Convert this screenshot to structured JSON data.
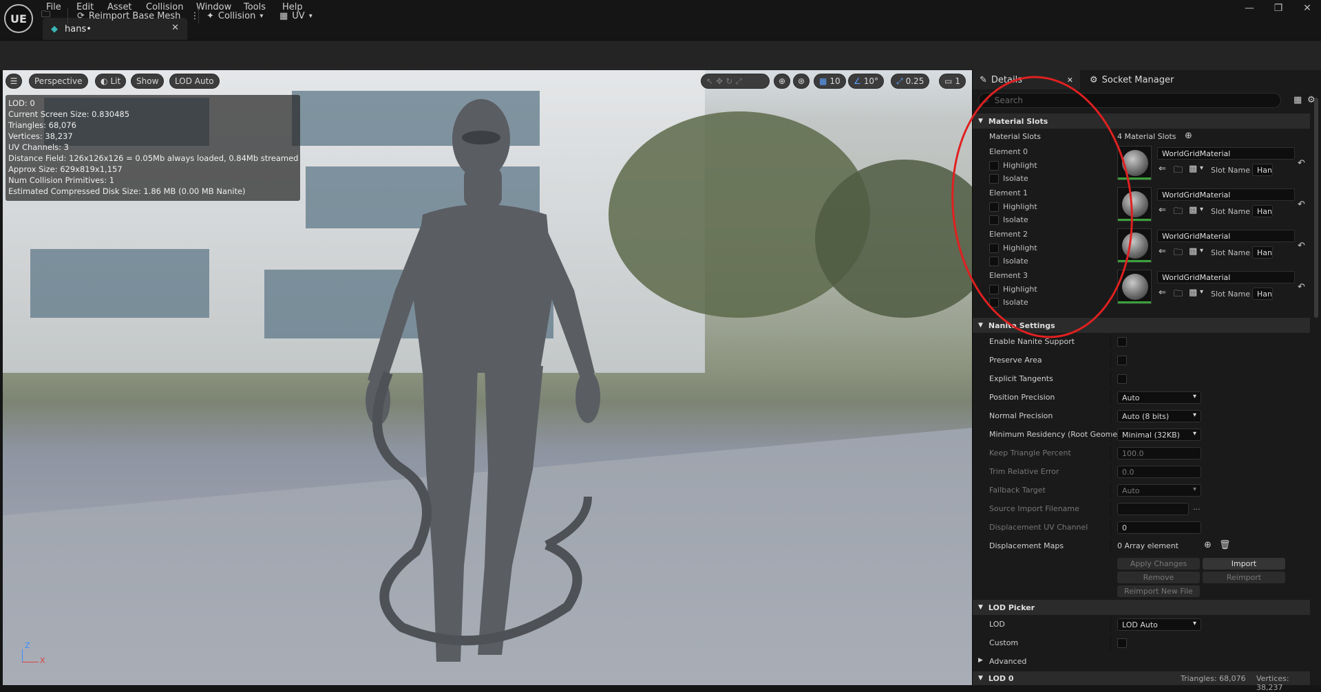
{
  "menu": [
    "File",
    "Edit",
    "Asset",
    "Collision",
    "Window",
    "Tools",
    "Help"
  ],
  "logo": "UE",
  "tab": {
    "name": "hans•"
  },
  "toolbar": {
    "reimport_label": "Reimport Base Mesh",
    "collision_label": "Collision",
    "uv_label": "UV"
  },
  "viewport": {
    "perspective": "Perspective",
    "lit": "Lit",
    "show": "Show",
    "lod": "LOD Auto",
    "grid_value": "10",
    "angle_value": "10°",
    "scale_value": "0.25",
    "camera_value": "1",
    "stats": [
      "LOD:  0",
      "Current Screen Size:  0.830485",
      "Triangles:  68,076",
      "Vertices:  38,237",
      "UV Channels:  3",
      "Distance Field:  126x126x126 = 0.05Mb always loaded, 0.84Mb streamed",
      "Approx Size: 629x819x1,157",
      "Num Collision Primitives:  1",
      "Estimated Compressed Disk Size: 1.86 MB (0.00 MB Nanite)"
    ],
    "axis_z": "Z",
    "axis_x": "X"
  },
  "panel": {
    "details_tab": "Details",
    "socket_tab": "Socket Manager",
    "search_placeholder": "Search",
    "material_section": "Material Slots",
    "material_slots_label": "Material Slots",
    "material_slots_value": "4 Material Slots",
    "highlight_label": "Highlight",
    "isolate_label": "Isolate",
    "slot_name_label": "Slot Name",
    "elements": [
      {
        "label": "Element 0",
        "material": "WorldGridMaterial",
        "slot": "Hans"
      },
      {
        "label": "Element 1",
        "material": "WorldGridMaterial",
        "slot": "Hans"
      },
      {
        "label": "Element 2",
        "material": "WorldGridMaterial",
        "slot": "Hans"
      },
      {
        "label": "Element 3",
        "material": "WorldGridMaterial",
        "slot": "Hans"
      }
    ],
    "nanite_section": "Nanite Settings",
    "nanite": {
      "enable": "Enable Nanite Support",
      "preserve": "Preserve Area",
      "tangents": "Explicit Tangents",
      "position_precision": "Position Precision",
      "position_value": "Auto",
      "normal_precision": "Normal Precision",
      "normal_value": "Auto (8 bits)",
      "min_residency": "Minimum Residency (Root Geome",
      "min_residency_value": "Minimal (32KB)",
      "keep_triangle": "Keep Triangle Percent",
      "keep_triangle_value": "100.0",
      "trim_error": "Trim Relative Error",
      "trim_error_value": "0.0",
      "fallback": "Fallback Target",
      "fallback_value": "Auto",
      "source_import": "Source Import Filename",
      "source_import_dots": "...",
      "disp_uv": "Displacement UV Channel",
      "disp_uv_value": "0",
      "disp_maps": "Displacement Maps",
      "disp_maps_value": "0 Array element",
      "apply_changes": "Apply Changes",
      "import": "Import",
      "remove": "Remove",
      "reimport": "Reimport",
      "reimport_new": "Reimport New File"
    },
    "lod_section": "LOD Picker",
    "lod_label": "LOD",
    "lod_value": "LOD Auto",
    "custom_label": "Custom",
    "advanced_label": "Advanced",
    "lod0_section": "LOD 0",
    "lod0_tris": "Triangles: 68,076",
    "lod0_verts": "Vertices: 38,237"
  }
}
